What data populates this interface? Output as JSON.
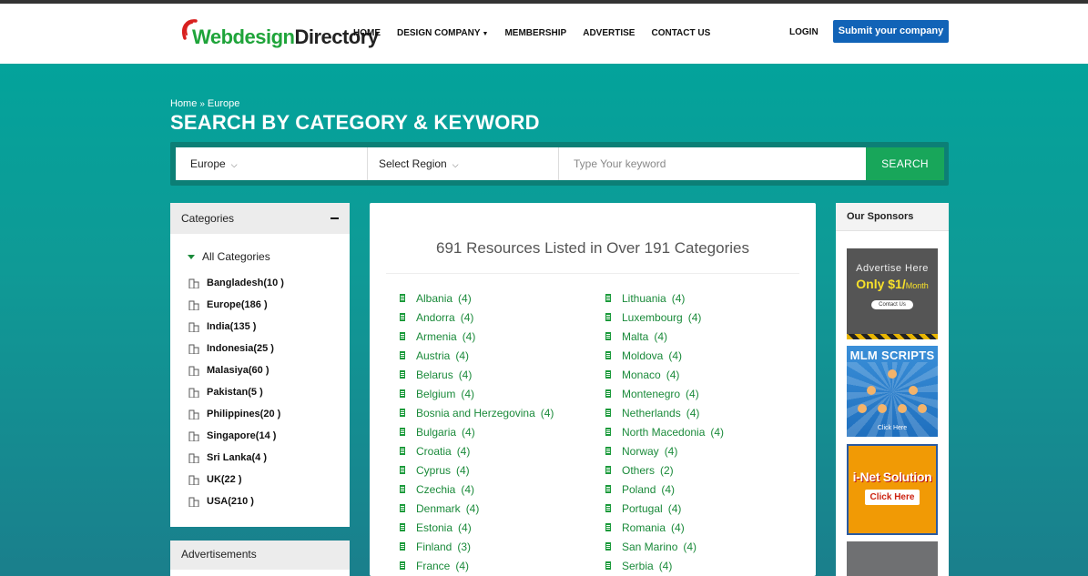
{
  "logo": {
    "part1": "Webdesign",
    "part2": "Directory"
  },
  "nav": {
    "items": [
      {
        "label": "HOME"
      },
      {
        "label": "DESIGN COMPANY"
      },
      {
        "label": "MEMBERSHIP"
      },
      {
        "label": "ADVERTISE"
      },
      {
        "label": "CONTACT US"
      }
    ],
    "login": "LOGIN",
    "submit": "Submit your company"
  },
  "breadcrumb": {
    "home": "Home",
    "sep": "»",
    "current": "Europe"
  },
  "title": "SEARCH BY CATEGORY & KEYWORD",
  "search": {
    "category": "Europe",
    "region": "Select Region",
    "placeholder": "Type Your keyword",
    "button": "SEARCH"
  },
  "categories": {
    "header": "Categories",
    "all": "All Categories",
    "items": [
      {
        "label": "Bangladesh(10 )"
      },
      {
        "label": "Europe(186 )"
      },
      {
        "label": "India(135 )"
      },
      {
        "label": "Indonesia(25 )"
      },
      {
        "label": "Malasiya(60 )"
      },
      {
        "label": "Pakistan(5 )"
      },
      {
        "label": "Philippines(20 )"
      },
      {
        "label": "Singapore(14 )"
      },
      {
        "label": "Sri Lanka(4 )"
      },
      {
        "label": "UK(22 )"
      },
      {
        "label": "USA(210 )"
      }
    ]
  },
  "advertisements": {
    "header": "Advertisements"
  },
  "main": {
    "title": "691 Resources Listed in Over 191 Categories",
    "col1": [
      {
        "name": "Albania",
        "count": "(4)"
      },
      {
        "name": "Andorra",
        "count": "(4)"
      },
      {
        "name": "Armenia",
        "count": "(4)"
      },
      {
        "name": "Austria",
        "count": "(4)"
      },
      {
        "name": "Belarus",
        "count": "(4)"
      },
      {
        "name": "Belgium",
        "count": "(4)"
      },
      {
        "name": "Bosnia and Herzegovina",
        "count": "(4)"
      },
      {
        "name": "Bulgaria",
        "count": "(4)"
      },
      {
        "name": "Croatia",
        "count": "(4)"
      },
      {
        "name": "Cyprus",
        "count": "(4)"
      },
      {
        "name": "Czechia",
        "count": "(4)"
      },
      {
        "name": "Denmark",
        "count": "(4)"
      },
      {
        "name": "Estonia",
        "count": "(4)"
      },
      {
        "name": "Finland",
        "count": "(3)"
      },
      {
        "name": "France",
        "count": "(4)"
      }
    ],
    "col2": [
      {
        "name": "Lithuania",
        "count": "(4)"
      },
      {
        "name": "Luxembourg",
        "count": "(4)"
      },
      {
        "name": "Malta",
        "count": "(4)"
      },
      {
        "name": "Moldova",
        "count": "(4)"
      },
      {
        "name": "Monaco",
        "count": "(4)"
      },
      {
        "name": "Montenegro",
        "count": "(4)"
      },
      {
        "name": "Netherlands",
        "count": "(4)"
      },
      {
        "name": "North Macedonia",
        "count": "(4)"
      },
      {
        "name": "Norway",
        "count": "(4)"
      },
      {
        "name": "Others",
        "count": "(2)"
      },
      {
        "name": "Poland",
        "count": "(4)"
      },
      {
        "name": "Portugal",
        "count": "(4)"
      },
      {
        "name": "Romania",
        "count": "(4)"
      },
      {
        "name": "San Marino",
        "count": "(4)"
      },
      {
        "name": "Serbia",
        "count": "(4)"
      }
    ]
  },
  "sponsors": {
    "header": "Our Sponsors",
    "ad1": {
      "line1": "Advertise Here",
      "price": "Only $1/",
      "unit": "Month",
      "button": "Contact Us"
    },
    "ad2": {
      "title": "MLM SCRIPTS",
      "cta": "Click Here"
    },
    "ad3": {
      "title": "i-Net Solution",
      "button": "Click Here"
    }
  },
  "colors": {
    "accent_green": "#1a8a3a",
    "hero_teal": "#03a39b",
    "submit_blue": "#1163b7",
    "search_green": "#18a65a"
  }
}
